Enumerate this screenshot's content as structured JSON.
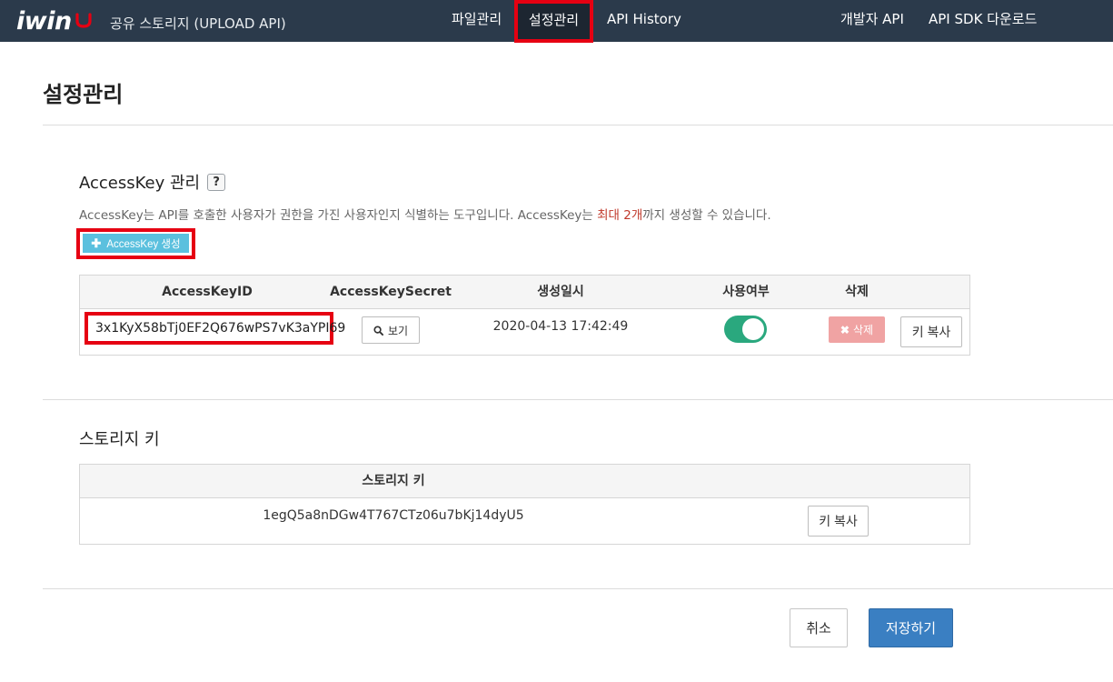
{
  "navbar": {
    "logo_text": "iwin",
    "brand_subtitle": "공유 스토리지 (UPLOAD API)",
    "items": [
      {
        "label": "파일관리"
      },
      {
        "label": "설정관리"
      },
      {
        "label": "API History"
      },
      {
        "label": "개발자 API"
      },
      {
        "label": "API SDK 다운로드"
      }
    ],
    "active_item": "설정관리"
  },
  "page": {
    "title": "설정관리"
  },
  "accesskey_section": {
    "title": "AccessKey 관리",
    "help_label": "?",
    "description_pre": "AccessKey는 API를 호출한 사용자가 권한을 가진 사용자인지 식별하는 도구입니다. AccessKey는 ",
    "description_highlight": "최대 2개",
    "description_post": "까지 생성할 수 있습니다.",
    "create_button": "AccessKey 생성",
    "create_icon": "plus-icon",
    "table": {
      "headers": [
        "AccessKeyID",
        "AccessKeySecret",
        "생성일시",
        "사용여부",
        "삭제"
      ],
      "rows": [
        {
          "access_key_id": "3x1KyX58bTj0EF2Q676wPS7vK3aYPI69",
          "secret_button": "보기",
          "created_at": "2020-04-13 17:42:49",
          "enabled": true,
          "delete_button": "삭제",
          "copy_button": "키 복사"
        }
      ]
    }
  },
  "storage_section": {
    "title": "스토리지 키",
    "table": {
      "header": "스토리지 키",
      "key_value": "1egQ5a8nDGw4T767CTz06u7bKj14dyU5",
      "copy_button": "키 복사"
    }
  },
  "footer": {
    "cancel_button": "취소",
    "save_button": "저장하기"
  },
  "colors": {
    "navbar_bg": "#2b3a4b",
    "highlight_frame": "#e60012",
    "create_button_bg": "#5bc0de",
    "toggle_on": "#2aa87e",
    "delete_disabled": "#f0a3a3",
    "save_button_bg": "#3a7fc2",
    "description_highlight": "#c0392b"
  }
}
